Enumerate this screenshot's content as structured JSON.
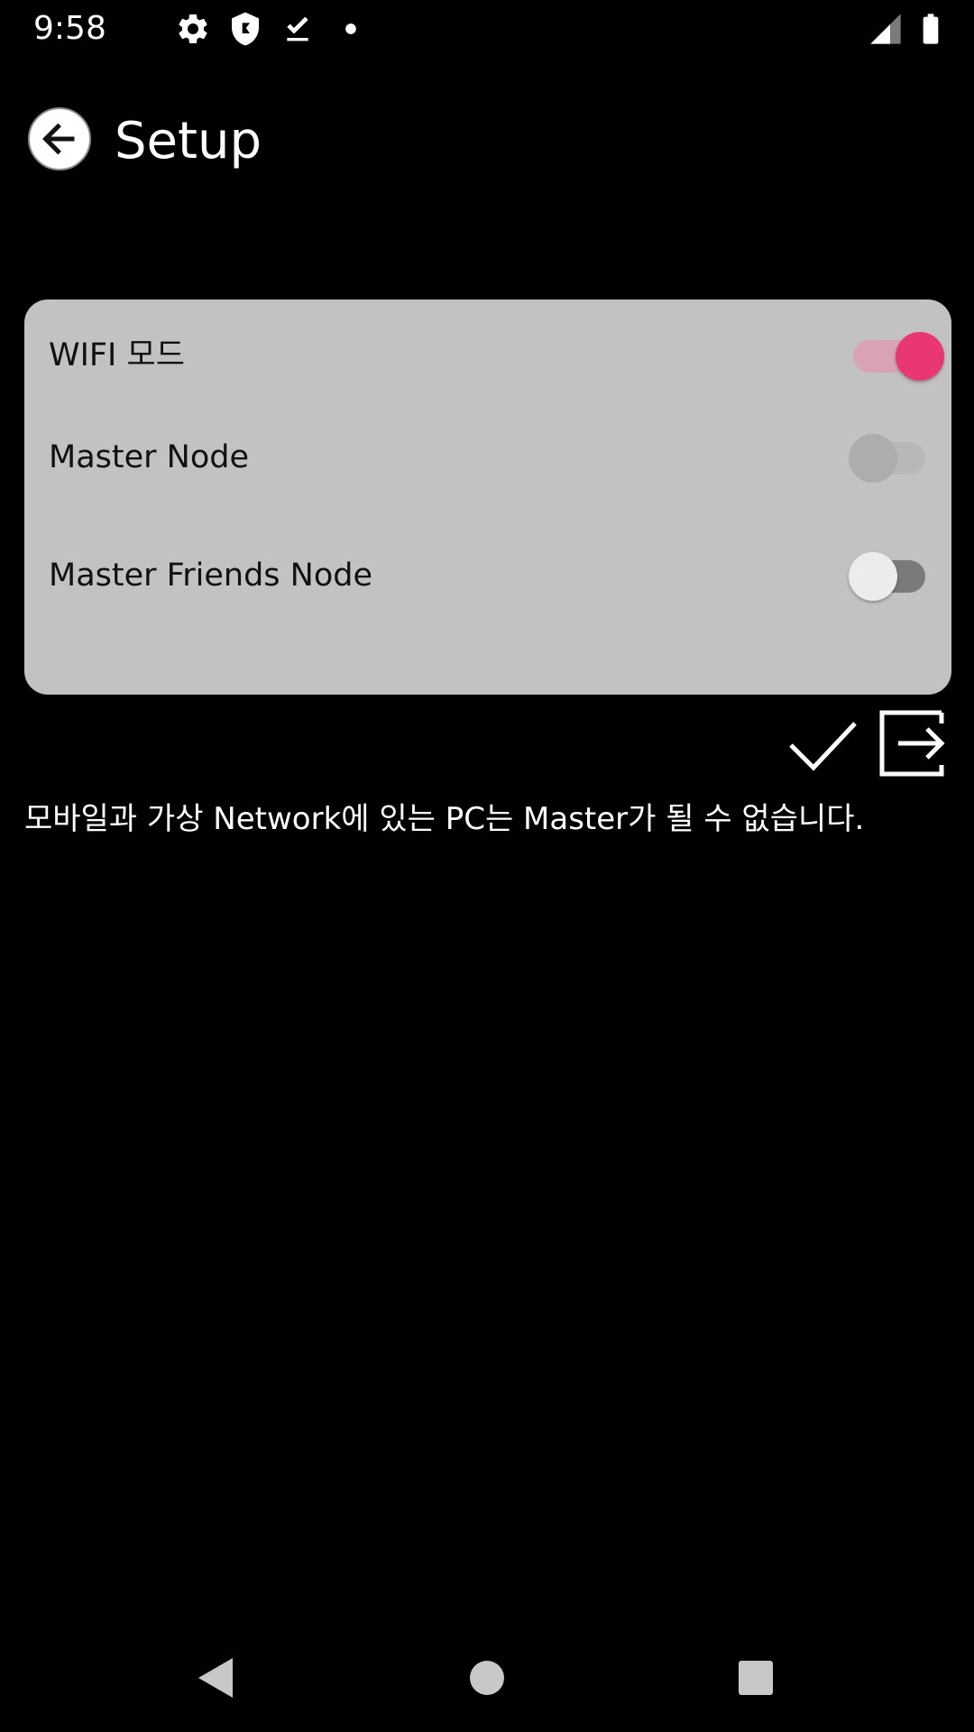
{
  "status_bar": {
    "time": "9:58",
    "icons": [
      "settings-icon",
      "shield-icon",
      "download-done-icon",
      "notification-dot-icon",
      "cell-signal-icon",
      "battery-icon"
    ]
  },
  "app_bar": {
    "title": "Setup",
    "back_icon": "arrow-left-icon"
  },
  "settings": {
    "items": [
      {
        "label": "WIFI 모드",
        "state": "on"
      },
      {
        "label": "Master Node",
        "state": "disabled"
      },
      {
        "label": "Master Friends Node",
        "state": "off"
      }
    ]
  },
  "actions": {
    "confirm_icon": "check-icon",
    "exit_icon": "exit-icon"
  },
  "info": {
    "message": "모바일과 가상 Network에 있는 PC는 Master가 될 수 없습니다."
  },
  "nav_bar": {
    "icons": [
      "back-triangle-icon",
      "home-circle-icon",
      "recents-square-icon"
    ]
  },
  "colors": {
    "background": "#000000",
    "card": "#c2c2c2",
    "accent": "#e83773",
    "accent_track": "#d8a3b7",
    "text_on_card": "#111111",
    "text_on_dark": "#ffffff"
  }
}
